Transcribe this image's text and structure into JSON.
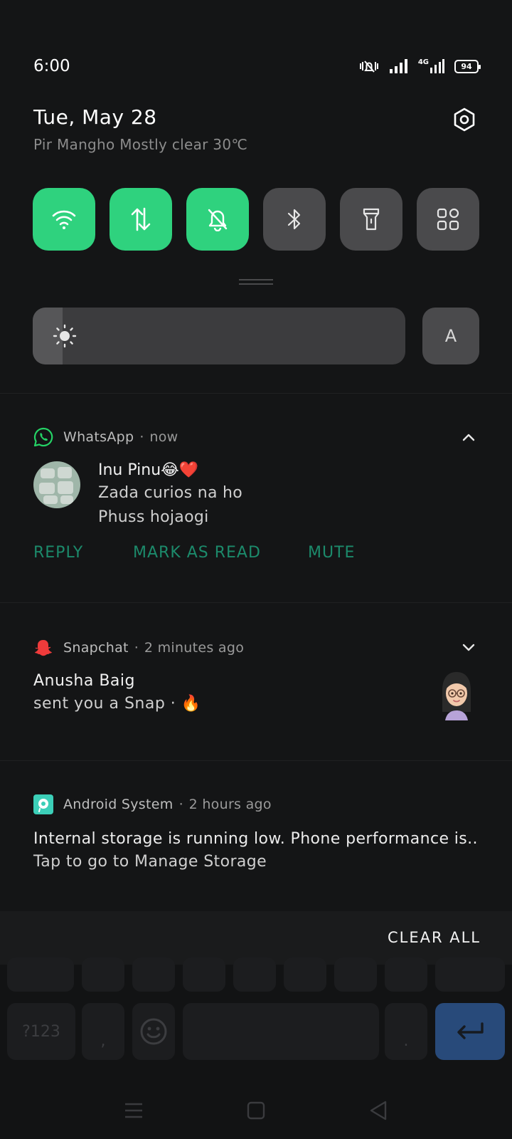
{
  "status_bar": {
    "time": "6:00",
    "network_label": "4G",
    "battery_level": "94"
  },
  "header": {
    "date": "Tue, May 28",
    "weather": "Pir Mangho Mostly clear 30℃"
  },
  "quick_tiles": [
    {
      "name": "wifi",
      "icon": "wifi-icon",
      "active": true
    },
    {
      "name": "mobile-data",
      "icon": "data-arrows-icon",
      "active": true
    },
    {
      "name": "silent-mode",
      "icon": "bell-off-icon",
      "active": true
    },
    {
      "name": "bluetooth",
      "icon": "bluetooth-icon",
      "active": false
    },
    {
      "name": "flashlight",
      "icon": "flashlight-icon",
      "active": false
    },
    {
      "name": "more-tiles",
      "icon": "grid-icon",
      "active": false
    }
  ],
  "brightness": {
    "level": 0.08,
    "auto_label": "A"
  },
  "notifications": {
    "whatsapp": {
      "app": "WhatsApp",
      "time": "now",
      "sender": "Inu Pinu😂❤️",
      "lines": [
        "Zada curios na ho",
        "Phuss hojaogi"
      ],
      "actions": [
        "REPLY",
        "MARK AS READ",
        "MUTE"
      ]
    },
    "snapchat": {
      "app": "Snapchat",
      "time": "2 minutes ago",
      "title": "Anusha Baig",
      "subtitle": "sent you a Snap · 🔥"
    },
    "android_system": {
      "app": "Android System",
      "time": "2 hours ago",
      "line1": "Internal storage is running low. Phone performance is..",
      "line2": "Tap to go to Manage Storage"
    }
  },
  "clear_all_label": "CLEAR ALL",
  "keyboard": {
    "symbols_key": "?123",
    "comma_key": ",",
    "period_key": "."
  },
  "colors": {
    "accent_green": "#2fd27e",
    "action_teal": "#1c8a6b",
    "whatsapp_green": "#25d366",
    "snapchat_red": "#ef3b3b",
    "android_teal": "#3ccfb8",
    "enter_key_blue": "#284a7a"
  },
  "dot": "·"
}
